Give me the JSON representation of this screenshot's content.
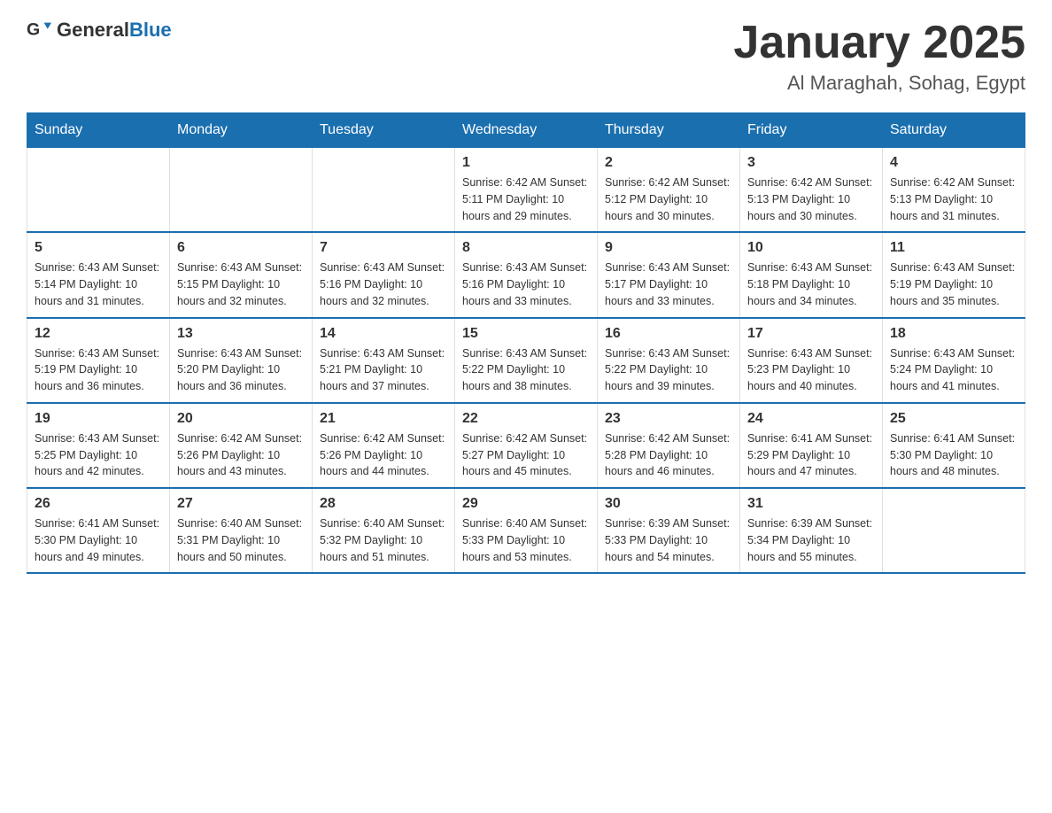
{
  "header": {
    "logo_general": "General",
    "logo_blue": "Blue",
    "title": "January 2025",
    "subtitle": "Al Maraghah, Sohag, Egypt"
  },
  "days_of_week": [
    "Sunday",
    "Monday",
    "Tuesday",
    "Wednesday",
    "Thursday",
    "Friday",
    "Saturday"
  ],
  "weeks": [
    [
      {
        "day": "",
        "info": ""
      },
      {
        "day": "",
        "info": ""
      },
      {
        "day": "",
        "info": ""
      },
      {
        "day": "1",
        "info": "Sunrise: 6:42 AM\nSunset: 5:11 PM\nDaylight: 10 hours\nand 29 minutes."
      },
      {
        "day": "2",
        "info": "Sunrise: 6:42 AM\nSunset: 5:12 PM\nDaylight: 10 hours\nand 30 minutes."
      },
      {
        "day": "3",
        "info": "Sunrise: 6:42 AM\nSunset: 5:13 PM\nDaylight: 10 hours\nand 30 minutes."
      },
      {
        "day": "4",
        "info": "Sunrise: 6:42 AM\nSunset: 5:13 PM\nDaylight: 10 hours\nand 31 minutes."
      }
    ],
    [
      {
        "day": "5",
        "info": "Sunrise: 6:43 AM\nSunset: 5:14 PM\nDaylight: 10 hours\nand 31 minutes."
      },
      {
        "day": "6",
        "info": "Sunrise: 6:43 AM\nSunset: 5:15 PM\nDaylight: 10 hours\nand 32 minutes."
      },
      {
        "day": "7",
        "info": "Sunrise: 6:43 AM\nSunset: 5:16 PM\nDaylight: 10 hours\nand 32 minutes."
      },
      {
        "day": "8",
        "info": "Sunrise: 6:43 AM\nSunset: 5:16 PM\nDaylight: 10 hours\nand 33 minutes."
      },
      {
        "day": "9",
        "info": "Sunrise: 6:43 AM\nSunset: 5:17 PM\nDaylight: 10 hours\nand 33 minutes."
      },
      {
        "day": "10",
        "info": "Sunrise: 6:43 AM\nSunset: 5:18 PM\nDaylight: 10 hours\nand 34 minutes."
      },
      {
        "day": "11",
        "info": "Sunrise: 6:43 AM\nSunset: 5:19 PM\nDaylight: 10 hours\nand 35 minutes."
      }
    ],
    [
      {
        "day": "12",
        "info": "Sunrise: 6:43 AM\nSunset: 5:19 PM\nDaylight: 10 hours\nand 36 minutes."
      },
      {
        "day": "13",
        "info": "Sunrise: 6:43 AM\nSunset: 5:20 PM\nDaylight: 10 hours\nand 36 minutes."
      },
      {
        "day": "14",
        "info": "Sunrise: 6:43 AM\nSunset: 5:21 PM\nDaylight: 10 hours\nand 37 minutes."
      },
      {
        "day": "15",
        "info": "Sunrise: 6:43 AM\nSunset: 5:22 PM\nDaylight: 10 hours\nand 38 minutes."
      },
      {
        "day": "16",
        "info": "Sunrise: 6:43 AM\nSunset: 5:22 PM\nDaylight: 10 hours\nand 39 minutes."
      },
      {
        "day": "17",
        "info": "Sunrise: 6:43 AM\nSunset: 5:23 PM\nDaylight: 10 hours\nand 40 minutes."
      },
      {
        "day": "18",
        "info": "Sunrise: 6:43 AM\nSunset: 5:24 PM\nDaylight: 10 hours\nand 41 minutes."
      }
    ],
    [
      {
        "day": "19",
        "info": "Sunrise: 6:43 AM\nSunset: 5:25 PM\nDaylight: 10 hours\nand 42 minutes."
      },
      {
        "day": "20",
        "info": "Sunrise: 6:42 AM\nSunset: 5:26 PM\nDaylight: 10 hours\nand 43 minutes."
      },
      {
        "day": "21",
        "info": "Sunrise: 6:42 AM\nSunset: 5:26 PM\nDaylight: 10 hours\nand 44 minutes."
      },
      {
        "day": "22",
        "info": "Sunrise: 6:42 AM\nSunset: 5:27 PM\nDaylight: 10 hours\nand 45 minutes."
      },
      {
        "day": "23",
        "info": "Sunrise: 6:42 AM\nSunset: 5:28 PM\nDaylight: 10 hours\nand 46 minutes."
      },
      {
        "day": "24",
        "info": "Sunrise: 6:41 AM\nSunset: 5:29 PM\nDaylight: 10 hours\nand 47 minutes."
      },
      {
        "day": "25",
        "info": "Sunrise: 6:41 AM\nSunset: 5:30 PM\nDaylight: 10 hours\nand 48 minutes."
      }
    ],
    [
      {
        "day": "26",
        "info": "Sunrise: 6:41 AM\nSunset: 5:30 PM\nDaylight: 10 hours\nand 49 minutes."
      },
      {
        "day": "27",
        "info": "Sunrise: 6:40 AM\nSunset: 5:31 PM\nDaylight: 10 hours\nand 50 minutes."
      },
      {
        "day": "28",
        "info": "Sunrise: 6:40 AM\nSunset: 5:32 PM\nDaylight: 10 hours\nand 51 minutes."
      },
      {
        "day": "29",
        "info": "Sunrise: 6:40 AM\nSunset: 5:33 PM\nDaylight: 10 hours\nand 53 minutes."
      },
      {
        "day": "30",
        "info": "Sunrise: 6:39 AM\nSunset: 5:33 PM\nDaylight: 10 hours\nand 54 minutes."
      },
      {
        "day": "31",
        "info": "Sunrise: 6:39 AM\nSunset: 5:34 PM\nDaylight: 10 hours\nand 55 minutes."
      },
      {
        "day": "",
        "info": ""
      }
    ]
  ]
}
